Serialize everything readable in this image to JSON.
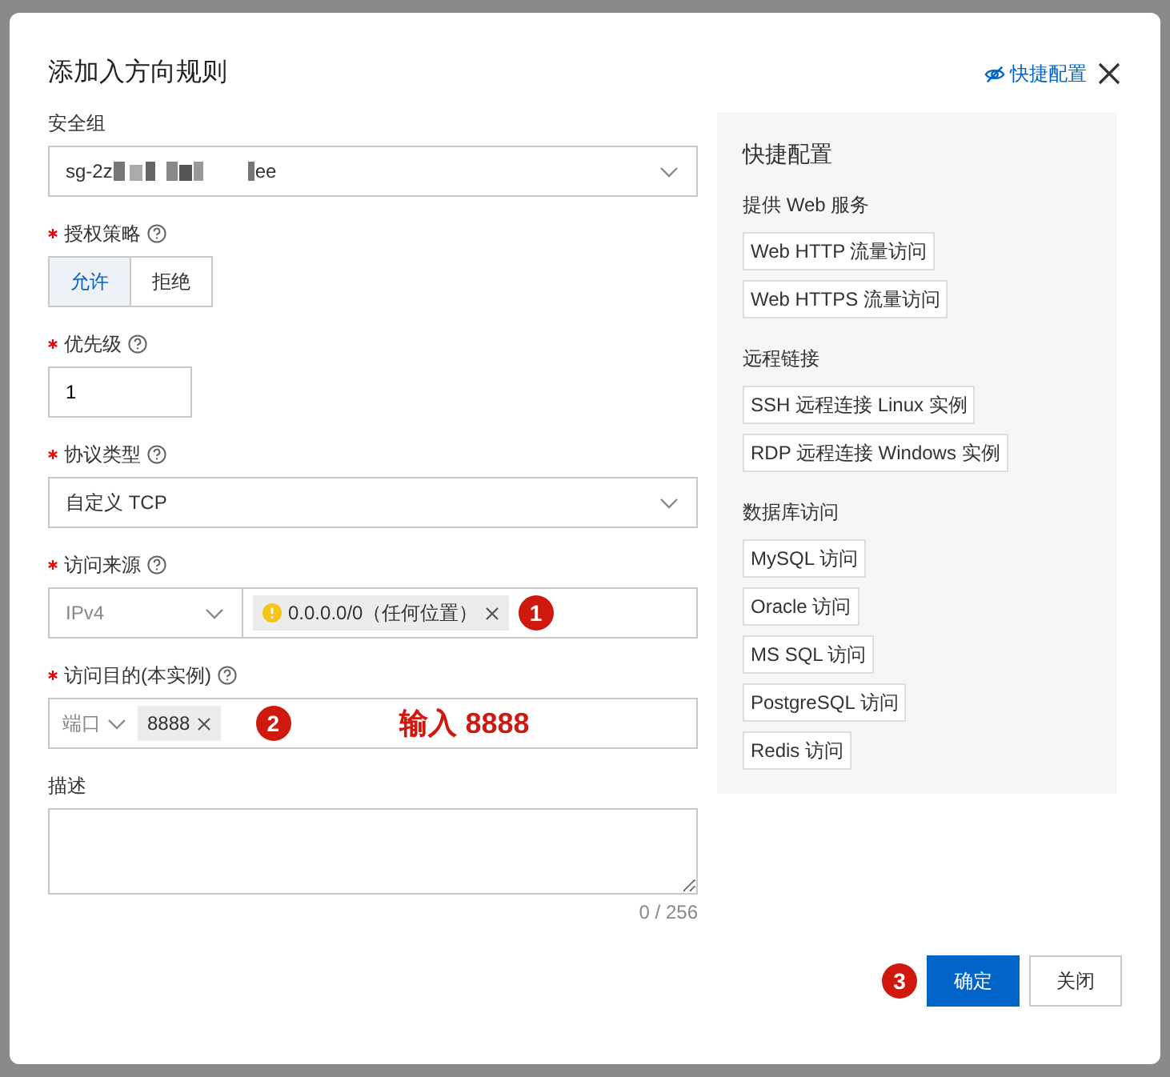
{
  "dialog": {
    "title": "添加入方向规则",
    "quick_toggle": "快捷配置"
  },
  "form": {
    "security_group": {
      "label": "安全组",
      "value_prefix": "sg-2z",
      "value_suffix": "ee"
    },
    "policy": {
      "label": "授权策略",
      "required": true,
      "options": [
        {
          "label": "允许",
          "selected": true
        },
        {
          "label": "拒绝",
          "selected": false
        }
      ]
    },
    "priority": {
      "label": "优先级",
      "required": true,
      "value": "1"
    },
    "protocol": {
      "label": "协议类型",
      "required": true,
      "value": "自定义 TCP"
    },
    "source": {
      "label": "访问来源",
      "required": true,
      "type": "IPv4",
      "tags": [
        "0.0.0.0/0（任何位置）"
      ],
      "marker": "1"
    },
    "destination": {
      "label": "访问目的(本实例)",
      "required": true,
      "type": "端口",
      "tags": [
        "8888"
      ],
      "marker": "2",
      "note": "输入 8888"
    },
    "description": {
      "label": "描述",
      "counter": "0 / 256"
    }
  },
  "quick_panel": {
    "title": "快捷配置",
    "groups": [
      {
        "name": "提供 Web 服务",
        "items": [
          "Web HTTP 流量访问",
          "Web HTTPS 流量访问"
        ]
      },
      {
        "name": "远程链接",
        "items": [
          "SSH 远程连接 Linux 实例",
          "RDP 远程连接 Windows 实例"
        ]
      },
      {
        "name": "数据库访问",
        "items": [
          "MySQL 访问",
          "Oracle 访问",
          "MS SQL 访问",
          "PostgreSQL 访问",
          "Redis 访问"
        ]
      }
    ]
  },
  "footer": {
    "marker": "3",
    "buttons": [
      {
        "label": "确定",
        "kind": "primary"
      },
      {
        "label": "关闭",
        "kind": "secondary"
      }
    ]
  }
}
